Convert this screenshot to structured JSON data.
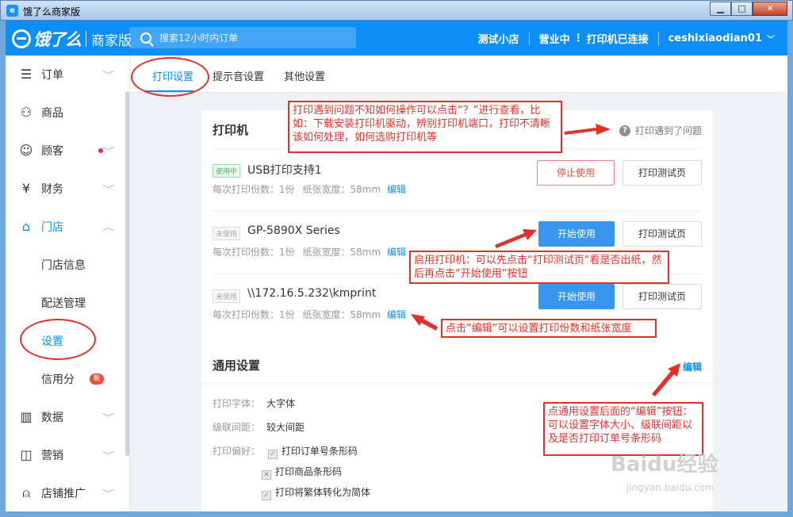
{
  "window": {
    "title": "饿了么商家版",
    "icon": "e",
    "btn_min": "▁",
    "btn_max": "□",
    "btn_close": "✕"
  },
  "header": {
    "logo_text": "饿了么",
    "logo_sub": "商家版",
    "search_placeholder": "搜索12小时内订单",
    "shop_name": "测试小店",
    "status_open": "营业中",
    "status_printer": "打印机已连接",
    "account": "ceshixiaodian01",
    "chevron": "﹀"
  },
  "sidebar": {
    "items": [
      {
        "label": "订单",
        "icon": "☰",
        "chev": "﹀"
      },
      {
        "label": "商品",
        "icon": "⚇"
      },
      {
        "label": "顾客",
        "icon": "☺",
        "chev": "﹀"
      },
      {
        "label": "财务",
        "icon": "¥",
        "chev": "﹀"
      },
      {
        "label": "门店",
        "icon": "⌂",
        "chev": "︿"
      },
      {
        "label": "门店信息"
      },
      {
        "label": "配送管理"
      },
      {
        "label": "设置"
      },
      {
        "label": "信用分",
        "badge": "新"
      },
      {
        "label": "数据",
        "icon": "▥",
        "chev": "﹀"
      },
      {
        "label": "营销",
        "icon": "◫",
        "chev": "﹀"
      },
      {
        "label": "店铺推广",
        "icon": "⍝",
        "chev": "﹀"
      }
    ]
  },
  "tabs": [
    "打印设置",
    "提示音设置",
    "其他设置"
  ],
  "printer_card": {
    "title": "打印机",
    "help": "打印遇到了问题",
    "help_icon": "?",
    "printers": [
      {
        "status": "使用中",
        "name": "USB打印支持1",
        "copies_label": "每次打印份数：",
        "copies": "1份",
        "width_label": "纸张宽度：",
        "width": "58mm",
        "edit": "编辑",
        "primary": "停止使用",
        "secondary": "打印测试页"
      },
      {
        "status": "未使用",
        "name": "GP-5890X Series",
        "copies_label": "每次打印份数：",
        "copies": "1份",
        "width_label": "纸张宽度：",
        "width": "58mm",
        "edit": "编辑",
        "primary": "开始使用",
        "secondary": "打印测试页"
      },
      {
        "status": "未使用",
        "name": "\\\\172.16.5.232\\kmprint",
        "copies_label": "每次打印份数：",
        "copies": "1份",
        "width_label": "纸张宽度：",
        "width": "58mm",
        "edit": "编辑",
        "primary": "开始使用",
        "secondary": "打印测试页"
      }
    ]
  },
  "general_card": {
    "title": "通用设置",
    "edit": "编辑",
    "font_label": "打印字体：",
    "font_value": "大字体",
    "spacing_label": "级联间距：",
    "spacing_value": "较大间距",
    "pref_label": "打印偏好：",
    "prefs": [
      "打印订单号条形码",
      "打印商品条形码",
      "打印将繁体转化为简体"
    ]
  },
  "annotations": {
    "help_note": "打印遇到问题不知如何操作可以点击“？”进行查看，比如：下载安装打印机驱动，辨别打印机端口，打印不清晰该如何处理，如何选购打印机等",
    "start_note": "启用打印机：可以先点击“打印测试页”看是否出纸，然后再点击“开始使用”按钮",
    "edit_note": "点击“编辑”可以设置打印份数和纸张宽度",
    "general_note": "点通用设置后面的“编辑”按钮：可以设置字体大小、级联间距以及是否打印订单号条形码"
  },
  "watermark": {
    "brand": "Baidu经验",
    "url": "jingyan.baidu.com"
  },
  "colors": {
    "brand_blue": "#0c8ef6",
    "annotation_red": "#e0322b",
    "start_button": "#3796ee"
  }
}
